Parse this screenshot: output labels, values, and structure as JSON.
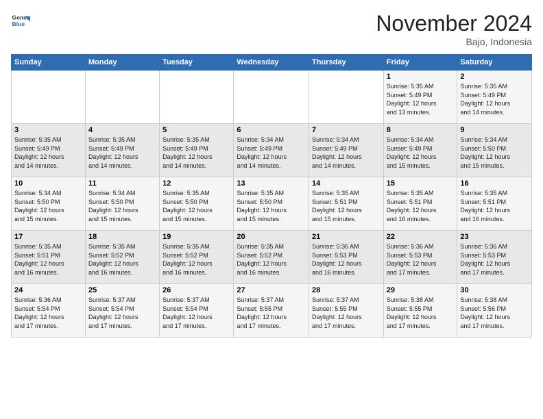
{
  "header": {
    "logo_general": "General",
    "logo_blue": "Blue",
    "month_title": "November 2024",
    "location": "Bajo, Indonesia"
  },
  "weekdays": [
    "Sunday",
    "Monday",
    "Tuesday",
    "Wednesday",
    "Thursday",
    "Friday",
    "Saturday"
  ],
  "weeks": [
    [
      {
        "day": "",
        "info": ""
      },
      {
        "day": "",
        "info": ""
      },
      {
        "day": "",
        "info": ""
      },
      {
        "day": "",
        "info": ""
      },
      {
        "day": "",
        "info": ""
      },
      {
        "day": "1",
        "info": "Sunrise: 5:35 AM\nSunset: 5:49 PM\nDaylight: 12 hours\nand 13 minutes."
      },
      {
        "day": "2",
        "info": "Sunrise: 5:35 AM\nSunset: 5:49 PM\nDaylight: 12 hours\nand 14 minutes."
      }
    ],
    [
      {
        "day": "3",
        "info": "Sunrise: 5:35 AM\nSunset: 5:49 PM\nDaylight: 12 hours\nand 14 minutes."
      },
      {
        "day": "4",
        "info": "Sunrise: 5:35 AM\nSunset: 5:49 PM\nDaylight: 12 hours\nand 14 minutes."
      },
      {
        "day": "5",
        "info": "Sunrise: 5:35 AM\nSunset: 5:49 PM\nDaylight: 12 hours\nand 14 minutes."
      },
      {
        "day": "6",
        "info": "Sunrise: 5:34 AM\nSunset: 5:49 PM\nDaylight: 12 hours\nand 14 minutes."
      },
      {
        "day": "7",
        "info": "Sunrise: 5:34 AM\nSunset: 5:49 PM\nDaylight: 12 hours\nand 14 minutes."
      },
      {
        "day": "8",
        "info": "Sunrise: 5:34 AM\nSunset: 5:49 PM\nDaylight: 12 hours\nand 15 minutes."
      },
      {
        "day": "9",
        "info": "Sunrise: 5:34 AM\nSunset: 5:50 PM\nDaylight: 12 hours\nand 15 minutes."
      }
    ],
    [
      {
        "day": "10",
        "info": "Sunrise: 5:34 AM\nSunset: 5:50 PM\nDaylight: 12 hours\nand 15 minutes."
      },
      {
        "day": "11",
        "info": "Sunrise: 5:34 AM\nSunset: 5:50 PM\nDaylight: 12 hours\nand 15 minutes."
      },
      {
        "day": "12",
        "info": "Sunrise: 5:35 AM\nSunset: 5:50 PM\nDaylight: 12 hours\nand 15 minutes."
      },
      {
        "day": "13",
        "info": "Sunrise: 5:35 AM\nSunset: 5:50 PM\nDaylight: 12 hours\nand 15 minutes."
      },
      {
        "day": "14",
        "info": "Sunrise: 5:35 AM\nSunset: 5:51 PM\nDaylight: 12 hours\nand 15 minutes."
      },
      {
        "day": "15",
        "info": "Sunrise: 5:35 AM\nSunset: 5:51 PM\nDaylight: 12 hours\nand 16 minutes."
      },
      {
        "day": "16",
        "info": "Sunrise: 5:35 AM\nSunset: 5:51 PM\nDaylight: 12 hours\nand 16 minutes."
      }
    ],
    [
      {
        "day": "17",
        "info": "Sunrise: 5:35 AM\nSunset: 5:51 PM\nDaylight: 12 hours\nand 16 minutes."
      },
      {
        "day": "18",
        "info": "Sunrise: 5:35 AM\nSunset: 5:52 PM\nDaylight: 12 hours\nand 16 minutes."
      },
      {
        "day": "19",
        "info": "Sunrise: 5:35 AM\nSunset: 5:52 PM\nDaylight: 12 hours\nand 16 minutes."
      },
      {
        "day": "20",
        "info": "Sunrise: 5:35 AM\nSunset: 5:52 PM\nDaylight: 12 hours\nand 16 minutes."
      },
      {
        "day": "21",
        "info": "Sunrise: 5:36 AM\nSunset: 5:53 PM\nDaylight: 12 hours\nand 16 minutes."
      },
      {
        "day": "22",
        "info": "Sunrise: 5:36 AM\nSunset: 5:53 PM\nDaylight: 12 hours\nand 17 minutes."
      },
      {
        "day": "23",
        "info": "Sunrise: 5:36 AM\nSunset: 5:53 PM\nDaylight: 12 hours\nand 17 minutes."
      }
    ],
    [
      {
        "day": "24",
        "info": "Sunrise: 5:36 AM\nSunset: 5:54 PM\nDaylight: 12 hours\nand 17 minutes."
      },
      {
        "day": "25",
        "info": "Sunrise: 5:37 AM\nSunset: 5:54 PM\nDaylight: 12 hours\nand 17 minutes."
      },
      {
        "day": "26",
        "info": "Sunrise: 5:37 AM\nSunset: 5:54 PM\nDaylight: 12 hours\nand 17 minutes."
      },
      {
        "day": "27",
        "info": "Sunrise: 5:37 AM\nSunset: 5:55 PM\nDaylight: 12 hours\nand 17 minutes."
      },
      {
        "day": "28",
        "info": "Sunrise: 5:37 AM\nSunset: 5:55 PM\nDaylight: 12 hours\nand 17 minutes."
      },
      {
        "day": "29",
        "info": "Sunrise: 5:38 AM\nSunset: 5:55 PM\nDaylight: 12 hours\nand 17 minutes."
      },
      {
        "day": "30",
        "info": "Sunrise: 5:38 AM\nSunset: 5:56 PM\nDaylight: 12 hours\nand 17 minutes."
      }
    ]
  ]
}
